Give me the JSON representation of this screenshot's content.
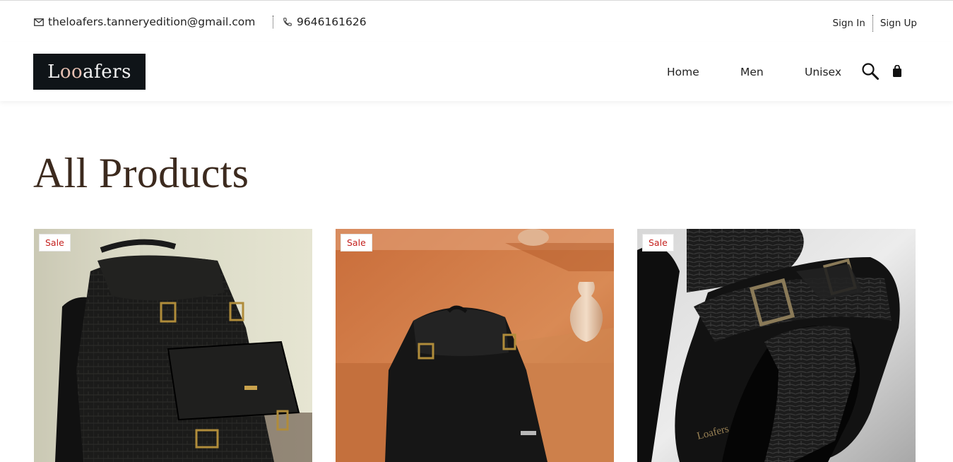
{
  "topbar": {
    "email": "theloafers.tanneryedition@gmail.com",
    "phone": "9646161626",
    "sign_in": "Sign In",
    "sign_up": "Sign Up"
  },
  "header": {
    "logo_prefix": "L",
    "logo_oo": "oo",
    "logo_suffix": "afers",
    "nav": {
      "home": "Home",
      "men": "Men",
      "unisex": "Unisex"
    },
    "icons": {
      "search": "search-icon",
      "cart": "shopping-bag-icon"
    }
  },
  "page": {
    "title": "All Products"
  },
  "products": [
    {
      "badge": "Sale"
    },
    {
      "badge": "Sale"
    },
    {
      "badge": "Sale"
    }
  ],
  "colors": {
    "title": "#3c2a1e",
    "sale_badge_text": "#c4201d",
    "logo_bg": "#0f1418"
  }
}
